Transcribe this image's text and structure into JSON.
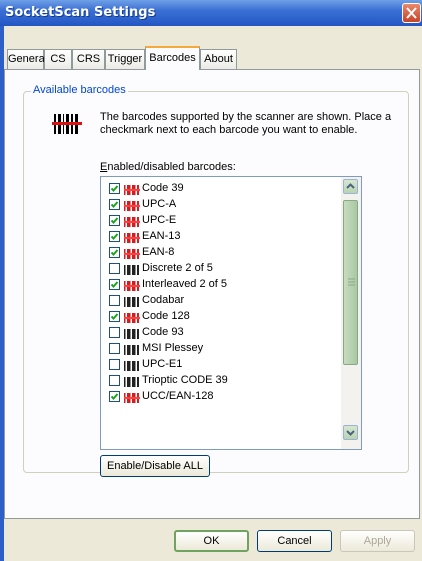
{
  "window": {
    "title": "SocketScan Settings"
  },
  "tabs": [
    {
      "label": "General"
    },
    {
      "label": "CS"
    },
    {
      "label": "CRS"
    },
    {
      "label": "Trigger"
    },
    {
      "label": "Barcodes"
    },
    {
      "label": "About"
    }
  ],
  "active_tab": "Barcodes",
  "group": {
    "label": "Available barcodes",
    "description": "The barcodes supported by the scanner are shown. Place a checkmark next to each barcode you want to enable."
  },
  "list": {
    "label_accel": "E",
    "label_rest": "nabled/disabled barcodes:",
    "items": [
      {
        "label": "Code 39",
        "checked": true
      },
      {
        "label": "UPC-A",
        "checked": true
      },
      {
        "label": "UPC-E",
        "checked": true
      },
      {
        "label": "EAN-13",
        "checked": true
      },
      {
        "label": "EAN-8",
        "checked": true
      },
      {
        "label": "Discrete 2 of 5",
        "checked": false
      },
      {
        "label": "Interleaved 2 of 5",
        "checked": true
      },
      {
        "label": "Codabar",
        "checked": false
      },
      {
        "label": "Code 128",
        "checked": true
      },
      {
        "label": "Code 93",
        "checked": false
      },
      {
        "label": "MSI Plessey",
        "checked": false
      },
      {
        "label": "UPC-E1",
        "checked": false
      },
      {
        "label": "Trioptic CODE 39",
        "checked": false
      },
      {
        "label": "UCC/EAN-128",
        "checked": true
      }
    ],
    "scroll_position": 0.0
  },
  "enable_all_label": "Enable/Disable ALL",
  "buttons": {
    "ok": "OK",
    "cancel": "Cancel",
    "apply": "Apply"
  },
  "colors": {
    "enabled_icon": "#d21e1e",
    "disabled_icon": "#222222",
    "accent": "#0046d5"
  }
}
